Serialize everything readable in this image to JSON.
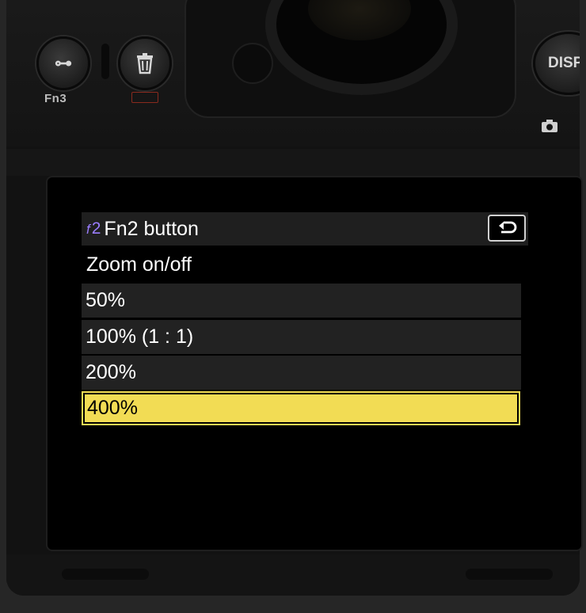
{
  "camera": {
    "fn3_label": "Fn3",
    "fn3_glyph": "⊶",
    "delete_glyph": "🗑",
    "disp_label": "DISP",
    "camera_glyph": "◘"
  },
  "menu": {
    "icon_prefix": "f",
    "icon_number": "2",
    "title": "Fn2 button",
    "back_icon": "return-arrow-icon",
    "setting_label": "Zoom on/off",
    "options": [
      {
        "label": "50%",
        "selected": false
      },
      {
        "label": "100% (1 : 1)",
        "selected": false
      },
      {
        "label": "200%",
        "selected": false
      },
      {
        "label": "400%",
        "selected": true
      }
    ]
  },
  "colors": {
    "highlight": "#f2dc54",
    "icon_accent": "#9a7dff",
    "option_bg": "#222222",
    "header_bg": "#1f1f1f"
  }
}
